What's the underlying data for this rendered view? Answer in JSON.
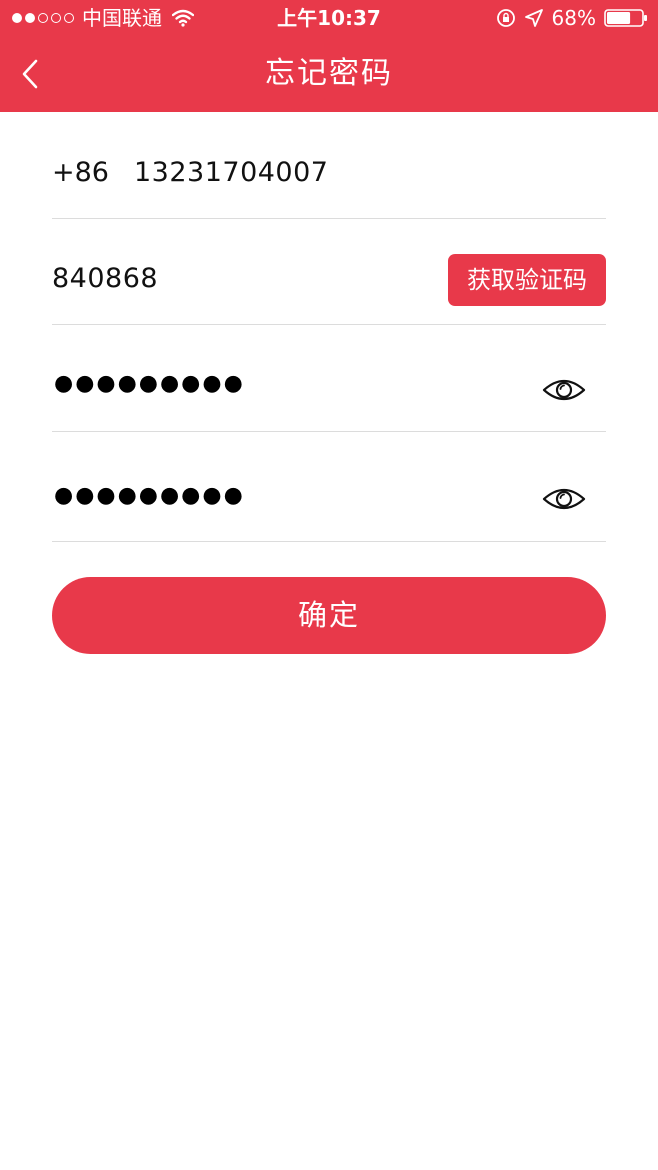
{
  "status_bar": {
    "carrier": "中国联通",
    "time": "上午10:37",
    "battery": "68%",
    "signal_strength_bars": 2,
    "signal_total_bars": 5,
    "battery_level": 0.68
  },
  "nav": {
    "title": "忘记密码",
    "back_icon": "chevron-left-icon"
  },
  "form": {
    "phone": {
      "country_code": "+86",
      "number": "13231704007"
    },
    "verification": {
      "code": "840868",
      "get_code_label": "获取验证码"
    },
    "password": {
      "masked": "●●●●●●●●●",
      "toggle_icon": "eye-icon"
    },
    "confirm_password": {
      "masked": "●●●●●●●●●",
      "toggle_icon": "eye-icon"
    },
    "confirm_label": "确定"
  },
  "colors": {
    "accent": "#e8394a",
    "divider": "#dcdcdc",
    "text": "#111111"
  }
}
